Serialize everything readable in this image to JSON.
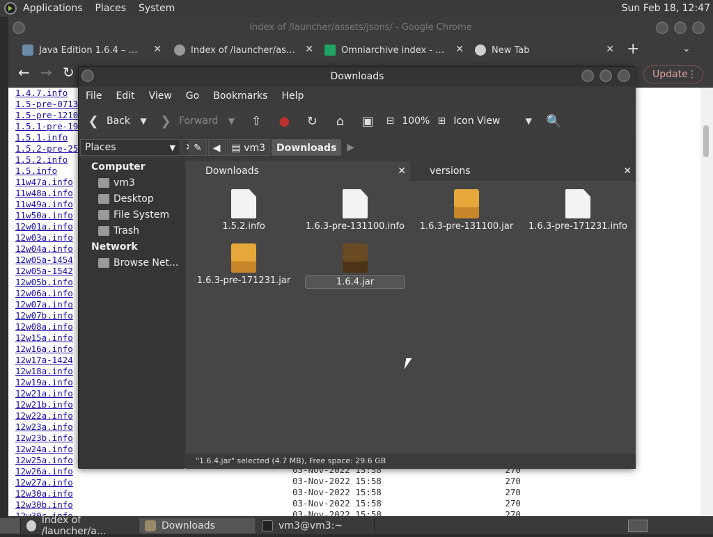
{
  "top_panel": {
    "menus": [
      "Applications",
      "Places",
      "System"
    ],
    "clock": "Sun Feb 18, 12:47"
  },
  "chrome": {
    "title": "Index of /launcher/assets/jsons/ - Google Chrome",
    "tabs": [
      {
        "label": "Java Edition 1.6.4 – Minec",
        "icon": "minecraft-icon"
      },
      {
        "label": "Index of /launcher/assets/j",
        "icon": "globe-icon"
      },
      {
        "label": "Omniarchive index - Goog",
        "icon": "sheets-icon"
      },
      {
        "label": "New Tab",
        "icon": "chrome-icon"
      }
    ],
    "new_tab": "+",
    "update_label": "Update",
    "links": [
      "1.4.7.info",
      "1.5-pre-0713",
      "1.5-pre-1210",
      "1.5.1-pre-19",
      "1.5.1.info",
      "1.5.2-pre-25",
      "1.5.2.info",
      "1.5.info",
      "11w47a.info",
      "11w48a.info",
      "11w49a.info",
      "11w50a.info",
      "12w01a.info",
      "12w03a.info",
      "12w04a.info",
      "12w05a-1454",
      "12w05a-1542",
      "12w05b.info",
      "12w06a.info",
      "12w07a.info",
      "12w07b.info",
      "12w08a.info",
      "12w15a.info",
      "12w16a.info",
      "12w17a-1424",
      "12w18a.info",
      "12w19a.info",
      "12w21a.info",
      "12w21b.info",
      "12w22a.info",
      "12w23a.info",
      "12w23b.info",
      "12w24a.info",
      "12w25a.info",
      "12w26a.info",
      "12w27a.info",
      "12w30a.info",
      "12w30b.info",
      "12w30c.info"
    ],
    "rows": [
      {
        "date": "03-Nov-2022 15:58",
        "size": "270"
      },
      {
        "date": "03-Nov-2022 15:58",
        "size": "270"
      },
      {
        "date": "03-Nov-2022 15:58",
        "size": "270"
      },
      {
        "date": "03-Nov-2022 15:58",
        "size": "270"
      },
      {
        "date": "03-Nov-2022 15:58",
        "size": "270"
      }
    ]
  },
  "nautilus": {
    "title": "Downloads",
    "menu": [
      "File",
      "Edit",
      "View",
      "Go",
      "Bookmarks",
      "Help"
    ],
    "toolbar": {
      "back": "Back",
      "forward": "Forward",
      "zoom": "100%",
      "view": "Icon View"
    },
    "places_label": "Places",
    "breadcrumbs": [
      "vm3",
      "Downloads"
    ],
    "sidebar": {
      "computer_header": "Computer",
      "computer_items": [
        "vm3",
        "Desktop",
        "File System",
        "Trash"
      ],
      "network_header": "Network",
      "network_items": [
        "Browse Net..."
      ]
    },
    "tabs": [
      "Downloads",
      "versions"
    ],
    "files": [
      {
        "name": "1.5.2.info",
        "type": "doc"
      },
      {
        "name": "1.6.3-pre-131100.info",
        "type": "doc"
      },
      {
        "name": "1.6.3-pre-131100.jar",
        "type": "jar"
      },
      {
        "name": "1.6.3-pre-171231.info",
        "type": "doc"
      },
      {
        "name": "1.6.3-pre-171231.jar",
        "type": "jar"
      },
      {
        "name": "1.6.4.jar",
        "type": "jar",
        "selected": true
      }
    ],
    "status": "\"1.6.4.jar\" selected (4.7 MB), Free space: 29.6 GB"
  },
  "taskbar": [
    {
      "label": "Index of /launcher/a...",
      "icon": "chrome-icon"
    },
    {
      "label": "Downloads",
      "icon": "folder-icon",
      "active": true
    },
    {
      "label": "vm3@vm3:~",
      "icon": "terminal-icon"
    }
  ]
}
